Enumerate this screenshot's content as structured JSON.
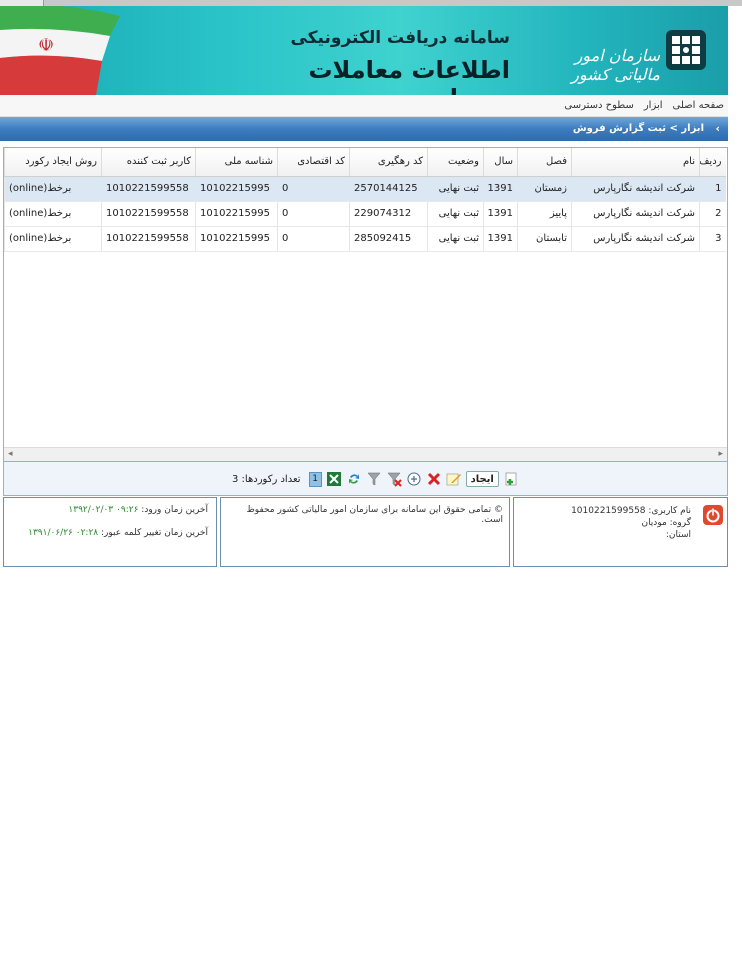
{
  "banner": {
    "title_small": "سامانه دریافت الکترونیکی",
    "title_big": "اطلاعات معاملات مودیان",
    "org_name": "سازمان امور مالیاتی کشور"
  },
  "menu": {
    "items": [
      "صفحه اصلی",
      "ابزار",
      "سطوح دسترسی"
    ]
  },
  "breadcrumb": {
    "text": "ابزار > ثبت گزارش فروش"
  },
  "grid": {
    "columns": [
      "ردیف",
      "نام",
      "فصل",
      "سال",
      "وضعیت",
      "کد رهگیری",
      "کد اقتصادی",
      "شناسه ملی",
      "کاربر ثبت کننده",
      "روش ایجاد رکورد"
    ],
    "rows": [
      {
        "idx": "1",
        "name": "شرکت اندیشه نگارپارس",
        "season": "زمستان",
        "year": "1391",
        "status": "ثبت نهایی",
        "tracking": "2570144125",
        "econ": "0",
        "national_id": "10102215995",
        "user": "1010221599558",
        "method": "(online)برخط"
      },
      {
        "idx": "2",
        "name": "شرکت اندیشه نگارپارس",
        "season": "پاییز",
        "year": "1391",
        "status": "ثبت نهایی",
        "tracking": "229074312",
        "econ": "0",
        "national_id": "10102215995",
        "user": "1010221599558",
        "method": "(online)برخط"
      },
      {
        "idx": "3",
        "name": "شرکت اندیشه نگارپارس",
        "season": "تابستان",
        "year": "1391",
        "status": "ثبت نهایی",
        "tracking": "285092415",
        "econ": "0",
        "national_id": "10102215995",
        "user": "1010221599558",
        "method": "(online)برخط"
      }
    ]
  },
  "toolbar": {
    "create_label": "ایجاد",
    "record_count": "تعداد رکوردها: 3",
    "page": "1"
  },
  "footer": {
    "last_login_label": "آخرین زمان ورود:",
    "last_login_value": "۰۹:۲۶ ۱۳۹۲/۰۲/۰۳",
    "last_pw_label": "آخرین زمان تغییر کلمه عبور:",
    "last_pw_value": "۰۲:۲۸ ۱۳۹۱/۰۶/۲۶",
    "copyright": "© تمامی حقوق این سامانه برای سازمان امور مالیاتی کشور محفوظ است.",
    "username": "نام کاربری: 1010221599558",
    "group": "گروه: مودیان",
    "province": "استان:"
  },
  "colors": {
    "banner": "#29c3c8",
    "crumbbar": "#3c7cc0",
    "selected_row": "#dbe7f3",
    "green_value": "#2e8b2e"
  }
}
